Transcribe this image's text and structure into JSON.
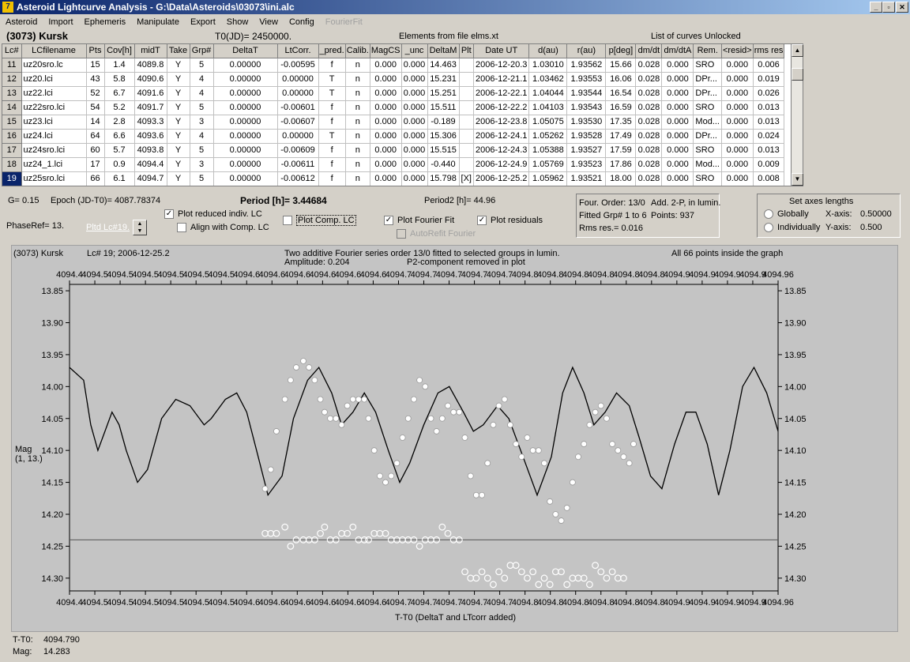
{
  "window": {
    "title": "Asteroid Lightcurve Analysis - G:\\Data\\Asteroids\\03073\\ini.alc",
    "icon": "app-logo-icon",
    "controls": [
      "_",
      "▫",
      "✕"
    ]
  },
  "menu": [
    "Asteroid",
    "Import",
    "Ephemeris",
    "Manipulate",
    "Export",
    "Show",
    "View",
    "Config",
    "FourierFit"
  ],
  "header": {
    "asteroid": "(3073) Kursk",
    "t0": "T0(JD)= 2450000.",
    "elements": "Elements from file elms.xt",
    "curves": "List of curves Unlocked"
  },
  "table": {
    "columns": [
      "Lc#",
      "LCfilename",
      "Pts",
      "Cov[h]",
      "midT",
      "Take",
      "Grp#",
      "DeltaT",
      "LtCorr.",
      "_pred.",
      "Calib.",
      "MagCS",
      "_unc",
      "DeltaM",
      "Plt",
      "Date UT",
      "d(au)",
      "r(au)",
      "p[deg]",
      "dm/dt",
      "dm/dtA",
      "Rem.",
      "<resid>",
      "rms res"
    ],
    "rows": [
      [
        "11",
        "uz20sro.lc",
        "15",
        "1.4",
        "4089.8",
        "Y",
        "5",
        "0.00000",
        "-0.00595",
        "f",
        "n",
        "0.000",
        "0.000",
        "14.463",
        "",
        "2006-12-20.3",
        "1.03010",
        "1.93562",
        "15.66",
        "0.028",
        "0.000",
        "SRO",
        "0.000",
        "0.006"
      ],
      [
        "12",
        "uz20.lci",
        "43",
        "5.8",
        "4090.6",
        "Y",
        "4",
        "0.00000",
        "0.00000",
        "T",
        "n",
        "0.000",
        "0.000",
        "15.231",
        "",
        "2006-12-21.1",
        "1.03462",
        "1.93553",
        "16.06",
        "0.028",
        "0.000",
        "DPr...",
        "0.000",
        "0.019"
      ],
      [
        "13",
        "uz22.lci",
        "52",
        "6.7",
        "4091.6",
        "Y",
        "4",
        "0.00000",
        "0.00000",
        "T",
        "n",
        "0.000",
        "0.000",
        "15.251",
        "",
        "2006-12-22.1",
        "1.04044",
        "1.93544",
        "16.54",
        "0.028",
        "0.000",
        "DPr...",
        "0.000",
        "0.026"
      ],
      [
        "14",
        "uz22sro.lci",
        "54",
        "5.2",
        "4091.7",
        "Y",
        "5",
        "0.00000",
        "-0.00601",
        "f",
        "n",
        "0.000",
        "0.000",
        "15.511",
        "",
        "2006-12-22.2",
        "1.04103",
        "1.93543",
        "16.59",
        "0.028",
        "0.000",
        "SRO",
        "0.000",
        "0.013"
      ],
      [
        "15",
        "uz23.lci",
        "14",
        "2.8",
        "4093.3",
        "Y",
        "3",
        "0.00000",
        "-0.00607",
        "f",
        "n",
        "0.000",
        "0.000",
        "-0.189",
        "",
        "2006-12-23.8",
        "1.05075",
        "1.93530",
        "17.35",
        "0.028",
        "0.000",
        "Mod...",
        "0.000",
        "0.013"
      ],
      [
        "16",
        "uz24.lci",
        "64",
        "6.6",
        "4093.6",
        "Y",
        "4",
        "0.00000",
        "0.00000",
        "T",
        "n",
        "0.000",
        "0.000",
        "15.306",
        "",
        "2006-12-24.1",
        "1.05262",
        "1.93528",
        "17.49",
        "0.028",
        "0.000",
        "DPr...",
        "0.000",
        "0.024"
      ],
      [
        "17",
        "uz24sro.lci",
        "60",
        "5.7",
        "4093.8",
        "Y",
        "5",
        "0.00000",
        "-0.00609",
        "f",
        "n",
        "0.000",
        "0.000",
        "15.515",
        "",
        "2006-12-24.3",
        "1.05388",
        "1.93527",
        "17.59",
        "0.028",
        "0.000",
        "SRO",
        "0.000",
        "0.013"
      ],
      [
        "18",
        "uz24_1.lci",
        "17",
        "0.9",
        "4094.4",
        "Y",
        "3",
        "0.00000",
        "-0.00611",
        "f",
        "n",
        "0.000",
        "0.000",
        "-0.440",
        "",
        "2006-12-24.9",
        "1.05769",
        "1.93523",
        "17.86",
        "0.028",
        "0.000",
        "Mod...",
        "0.000",
        "0.009"
      ],
      [
        "19",
        "uz25sro.lci",
        "66",
        "6.1",
        "4094.7",
        "Y",
        "5",
        "0.00000",
        "-0.00612",
        "f",
        "n",
        "0.000",
        "0.000",
        "15.798",
        "[X]",
        "2006-12-25.2",
        "1.05962",
        "1.93521",
        "18.00",
        "0.028",
        "0.000",
        "SRO",
        "0.000",
        "0.008"
      ]
    ],
    "selected_row": "19"
  },
  "controls": {
    "g": "G= 0.15",
    "epoch": "Epoch (JD-T0)= 4087.78374",
    "period_label": "Period [h]= ",
    "period_value": "3.44684",
    "period2": "Period2 [h]= 44.96",
    "phaseref": "PhaseRef= 13.",
    "pltd": "Pltd Lc#19.",
    "plot_reduced": "Plot reduced indiv. LC",
    "align_comp": "Align with Comp. LC",
    "plot_comp": "Plot Comp. LC",
    "plot_fourier": "Plot Fourier Fit",
    "plot_residuals": "Plot residuals",
    "autorefit": "AutoRefit Fourier"
  },
  "fourier_info": {
    "order": "Four. Order: 13/0",
    "add": "Add. 2-P, in lumin.",
    "fitted": "Fitted Grp# 1 to 6",
    "points": "Points: 937",
    "rms": "Rms res.= 0.016"
  },
  "axes_box": {
    "title": "Set axes lengths",
    "globally": "Globally",
    "individually": "Individually",
    "xaxis_label": "X-axis:",
    "xaxis_value": "0.50000",
    "yaxis_label": "Y-axis:",
    "yaxis_value": "0.500"
  },
  "plot_header": {
    "name": "(3073) Kursk",
    "lc": "Lc# 19; 2006-12-25.2",
    "line1": "Two additive Fourier series order 13/0 fitted to selected groups in lumin.",
    "line2": "Amplitude: 0.204",
    "line3": "P2-component removed in plot",
    "inside": "All 66 points inside the graph"
  },
  "chart_data": {
    "type": "scatter",
    "xlabel": "T-T0 (DeltaT and LTcorr added)",
    "ylabel": "Mag",
    "ylabel2": "(1, 13.)",
    "xlim": [
      4094.46,
      4094.96
    ],
    "ylim": [
      14.32,
      13.84
    ],
    "yticks": [
      "13.85",
      "13.90",
      "13.95",
      "14.00",
      "14.05",
      "14.10",
      "14.15",
      "14.20",
      "14.25",
      "14.30"
    ],
    "xticks": [
      "4094.4",
      "4094.5",
      "4094.5",
      "4094.5",
      "4094.5",
      "4094.5",
      "4094.5",
      "4094.6",
      "4094.6",
      "4094.6",
      "4094.6",
      "4094.6",
      "4094.6",
      "4094.7",
      "4094.7",
      "4094.7",
      "4094.7",
      "4094.7",
      "4094.8",
      "4094.8",
      "4094.8",
      "4094.8",
      "4094.8",
      "4094.8",
      "4094.9",
      "4094.9",
      "4094.9",
      "4094.9",
      "4094.96"
    ],
    "fit_line": [
      [
        4094.46,
        13.97
      ],
      [
        4094.47,
        13.99
      ],
      [
        4094.475,
        14.06
      ],
      [
        4094.48,
        14.1
      ],
      [
        4094.485,
        14.07
      ],
      [
        4094.49,
        14.04
      ],
      [
        4094.495,
        14.06
      ],
      [
        4094.5,
        14.1
      ],
      [
        4094.508,
        14.15
      ],
      [
        4094.515,
        14.13
      ],
      [
        4094.525,
        14.05
      ],
      [
        4094.535,
        14.02
      ],
      [
        4094.545,
        14.03
      ],
      [
        4094.555,
        14.06
      ],
      [
        4094.56,
        14.05
      ],
      [
        4094.57,
        14.02
      ],
      [
        4094.578,
        14.01
      ],
      [
        4094.585,
        14.04
      ],
      [
        4094.592,
        14.1
      ],
      [
        4094.6,
        14.17
      ],
      [
        4094.61,
        14.14
      ],
      [
        4094.618,
        14.05
      ],
      [
        4094.628,
        13.99
      ],
      [
        4094.636,
        13.97
      ],
      [
        4094.645,
        14.01
      ],
      [
        4094.652,
        14.06
      ],
      [
        4094.66,
        14.04
      ],
      [
        4094.668,
        14.01
      ],
      [
        4094.676,
        14.04
      ],
      [
        4094.685,
        14.1
      ],
      [
        4094.693,
        14.15
      ],
      [
        4094.7,
        14.12
      ],
      [
        4094.71,
        14.06
      ],
      [
        4094.72,
        14.01
      ],
      [
        4094.728,
        14.0
      ],
      [
        4094.738,
        14.04
      ],
      [
        4094.745,
        14.07
      ],
      [
        4094.752,
        14.06
      ],
      [
        4094.762,
        14.03
      ],
      [
        4094.77,
        14.05
      ],
      [
        4094.78,
        14.11
      ],
      [
        4094.79,
        14.17
      ],
      [
        4094.8,
        14.11
      ],
      [
        4094.808,
        14.01
      ],
      [
        4094.815,
        13.97
      ],
      [
        4094.823,
        14.01
      ],
      [
        4094.83,
        14.06
      ],
      [
        4094.838,
        14.04
      ],
      [
        4094.846,
        14.01
      ],
      [
        4094.855,
        14.03
      ],
      [
        4094.862,
        14.08
      ],
      [
        4094.87,
        14.14
      ],
      [
        4094.878,
        14.16
      ],
      [
        4094.887,
        14.09
      ],
      [
        4094.895,
        14.04
      ],
      [
        4094.902,
        14.04
      ],
      [
        4094.91,
        14.09
      ],
      [
        4094.918,
        14.17
      ],
      [
        4094.926,
        14.1
      ],
      [
        4094.935,
        14.0
      ],
      [
        4094.943,
        13.97
      ],
      [
        4094.952,
        14.01
      ],
      [
        4094.96,
        14.07
      ],
      [
        4094.968,
        14.1
      ],
      [
        4094.975,
        14.06
      ],
      [
        4094.983,
        14.02
      ],
      [
        4094.99,
        14.0
      ]
    ],
    "observed": [
      [
        4094.598,
        14.16
      ],
      [
        4094.602,
        14.13
      ],
      [
        4094.606,
        14.07
      ],
      [
        4094.612,
        14.02
      ],
      [
        4094.616,
        13.99
      ],
      [
        4094.62,
        13.97
      ],
      [
        4094.625,
        13.96
      ],
      [
        4094.629,
        13.97
      ],
      [
        4094.633,
        13.99
      ],
      [
        4094.637,
        14.02
      ],
      [
        4094.64,
        14.04
      ],
      [
        4094.644,
        14.05
      ],
      [
        4094.648,
        14.05
      ],
      [
        4094.652,
        14.06
      ],
      [
        4094.656,
        14.03
      ],
      [
        4094.66,
        14.02
      ],
      [
        4094.664,
        14.02
      ],
      [
        4094.668,
        14.02
      ],
      [
        4094.671,
        14.05
      ],
      [
        4094.675,
        14.1
      ],
      [
        4094.679,
        14.14
      ],
      [
        4094.683,
        14.15
      ],
      [
        4094.687,
        14.14
      ],
      [
        4094.691,
        14.12
      ],
      [
        4094.695,
        14.08
      ],
      [
        4094.699,
        14.05
      ],
      [
        4094.703,
        14.02
      ],
      [
        4094.707,
        13.99
      ],
      [
        4094.711,
        14.0
      ],
      [
        4094.715,
        14.05
      ],
      [
        4094.719,
        14.07
      ],
      [
        4094.723,
        14.05
      ],
      [
        4094.727,
        14.03
      ],
      [
        4094.731,
        14.04
      ],
      [
        4094.735,
        14.04
      ],
      [
        4094.739,
        14.08
      ],
      [
        4094.743,
        14.14
      ],
      [
        4094.747,
        14.17
      ],
      [
        4094.751,
        14.17
      ],
      [
        4094.755,
        14.12
      ],
      [
        4094.759,
        14.06
      ],
      [
        4094.763,
        14.03
      ],
      [
        4094.767,
        14.02
      ],
      [
        4094.771,
        14.06
      ],
      [
        4094.775,
        14.09
      ],
      [
        4094.779,
        14.11
      ],
      [
        4094.783,
        14.08
      ],
      [
        4094.787,
        14.1
      ],
      [
        4094.791,
        14.1
      ],
      [
        4094.795,
        14.12
      ],
      [
        4094.799,
        14.18
      ],
      [
        4094.803,
        14.2
      ],
      [
        4094.807,
        14.21
      ],
      [
        4094.811,
        14.19
      ],
      [
        4094.815,
        14.15
      ],
      [
        4094.819,
        14.11
      ],
      [
        4094.823,
        14.09
      ],
      [
        4094.827,
        14.06
      ],
      [
        4094.831,
        14.04
      ],
      [
        4094.835,
        14.03
      ],
      [
        4094.839,
        14.05
      ],
      [
        4094.843,
        14.09
      ],
      [
        4094.847,
        14.1
      ],
      [
        4094.851,
        14.11
      ],
      [
        4094.855,
        14.12
      ],
      [
        4094.858,
        14.09
      ]
    ],
    "residual_line": 14.24,
    "residuals": [
      [
        4094.598,
        14.23
      ],
      [
        4094.602,
        14.23
      ],
      [
        4094.606,
        14.23
      ],
      [
        4094.612,
        14.22
      ],
      [
        4094.616,
        14.25
      ],
      [
        4094.62,
        14.24
      ],
      [
        4094.625,
        14.24
      ],
      [
        4094.629,
        14.24
      ],
      [
        4094.633,
        14.24
      ],
      [
        4094.637,
        14.23
      ],
      [
        4094.64,
        14.22
      ],
      [
        4094.644,
        14.24
      ],
      [
        4094.648,
        14.24
      ],
      [
        4094.652,
        14.23
      ],
      [
        4094.656,
        14.23
      ],
      [
        4094.66,
        14.22
      ],
      [
        4094.664,
        14.24
      ],
      [
        4094.668,
        14.24
      ],
      [
        4094.671,
        14.24
      ],
      [
        4094.675,
        14.23
      ],
      [
        4094.679,
        14.23
      ],
      [
        4094.683,
        14.23
      ],
      [
        4094.687,
        14.24
      ],
      [
        4094.691,
        14.24
      ],
      [
        4094.695,
        14.24
      ],
      [
        4094.699,
        14.24
      ],
      [
        4094.703,
        14.24
      ],
      [
        4094.707,
        14.25
      ],
      [
        4094.711,
        14.24
      ],
      [
        4094.715,
        14.24
      ],
      [
        4094.719,
        14.24
      ],
      [
        4094.723,
        14.22
      ],
      [
        4094.727,
        14.23
      ],
      [
        4094.731,
        14.24
      ],
      [
        4094.735,
        14.24
      ],
      [
        4094.739,
        14.29
      ],
      [
        4094.743,
        14.3
      ],
      [
        4094.747,
        14.3
      ],
      [
        4094.751,
        14.29
      ],
      [
        4094.755,
        14.3
      ],
      [
        4094.759,
        14.31
      ],
      [
        4094.763,
        14.29
      ],
      [
        4094.767,
        14.3
      ],
      [
        4094.771,
        14.28
      ],
      [
        4094.775,
        14.28
      ],
      [
        4094.779,
        14.29
      ],
      [
        4094.783,
        14.3
      ],
      [
        4094.787,
        14.29
      ],
      [
        4094.791,
        14.31
      ],
      [
        4094.795,
        14.3
      ],
      [
        4094.799,
        14.31
      ],
      [
        4094.803,
        14.29
      ],
      [
        4094.807,
        14.29
      ],
      [
        4094.811,
        14.31
      ],
      [
        4094.815,
        14.3
      ],
      [
        4094.819,
        14.3
      ],
      [
        4094.823,
        14.3
      ],
      [
        4094.827,
        14.31
      ],
      [
        4094.831,
        14.28
      ],
      [
        4094.835,
        14.29
      ],
      [
        4094.839,
        14.3
      ],
      [
        4094.843,
        14.29
      ],
      [
        4094.847,
        14.3
      ],
      [
        4094.851,
        14.3
      ]
    ]
  },
  "status": {
    "t_label": "T-T0:",
    "t_value": "4094.790",
    "mag_label": "Mag:",
    "mag_value": "14.283"
  },
  "colors": {
    "window_bg": "#d4d0c8",
    "plot_bg": "#c4c4c4",
    "selection": "#0a246a"
  }
}
